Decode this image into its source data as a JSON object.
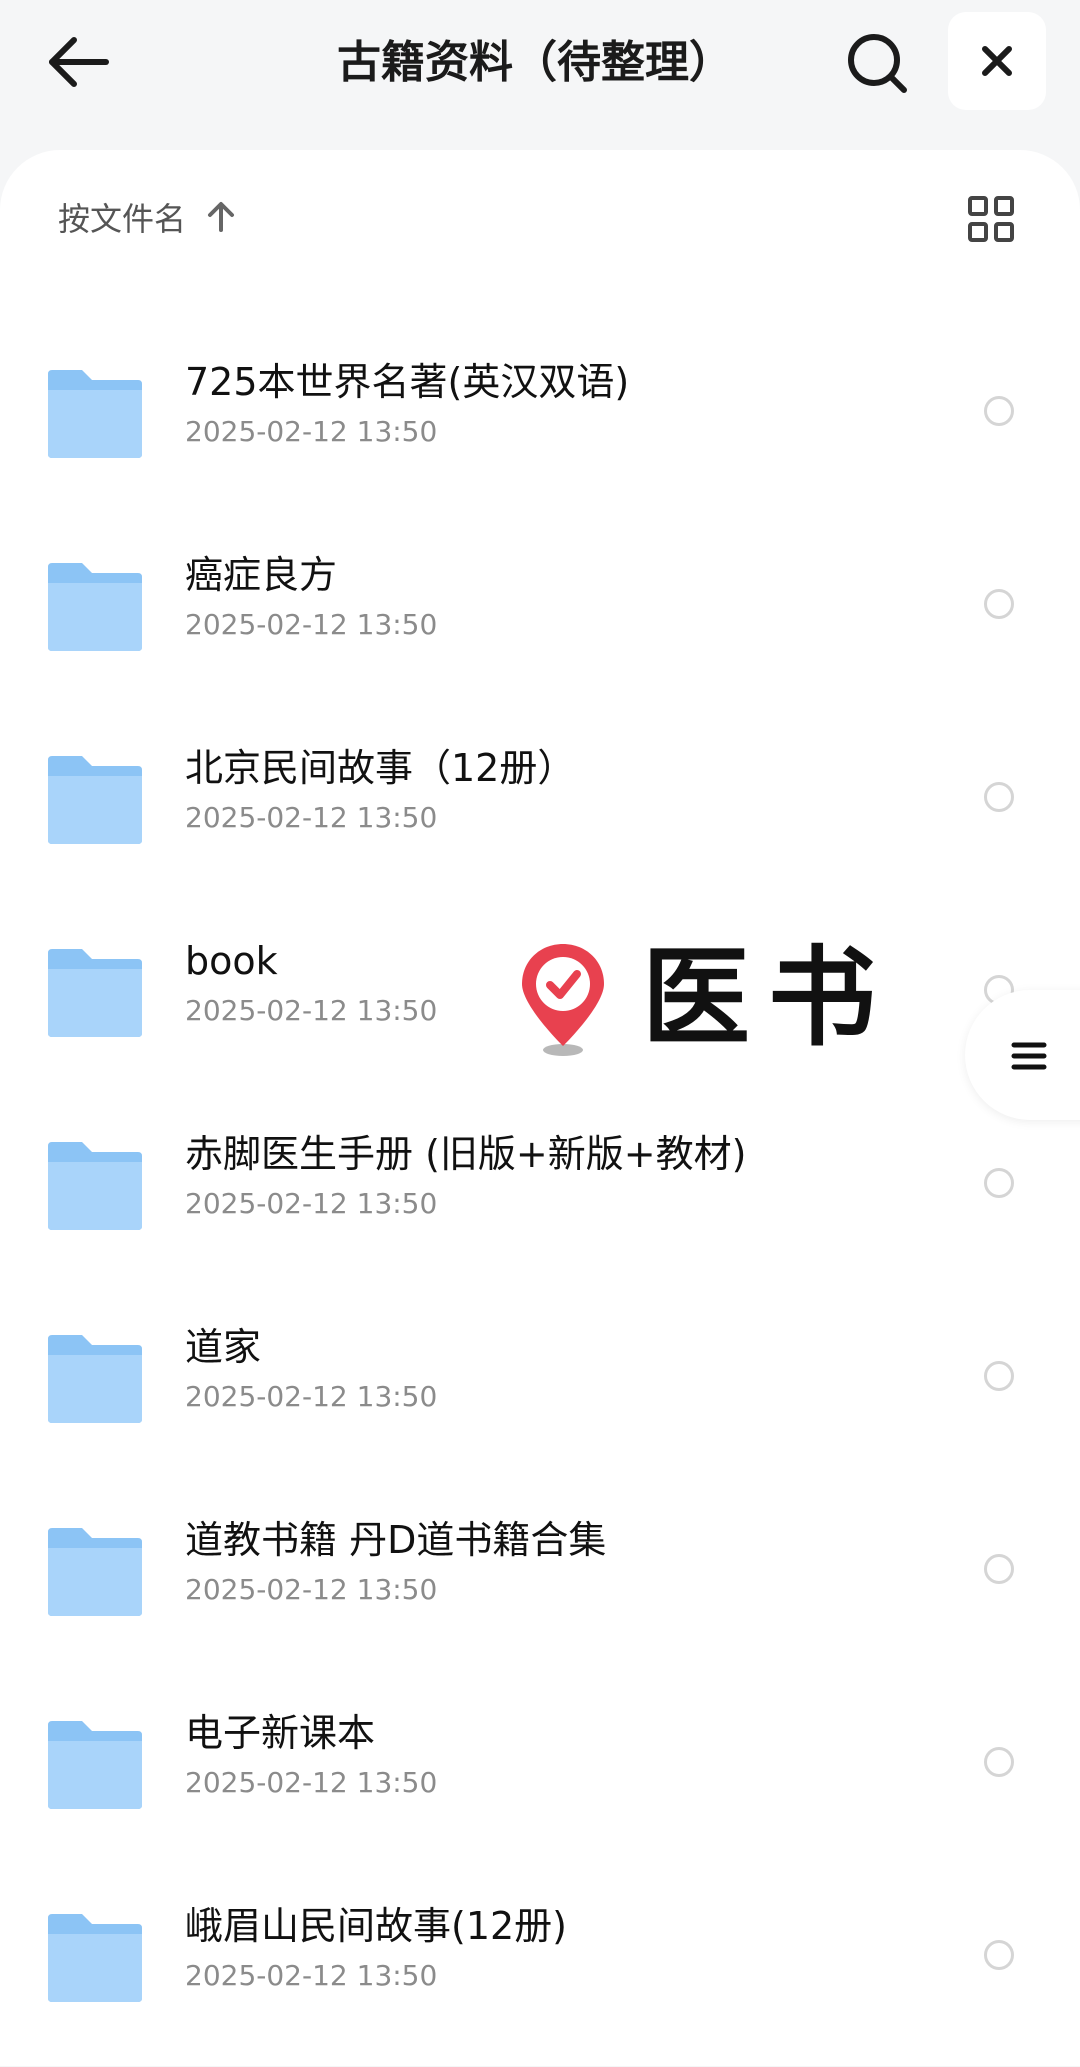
{
  "header": {
    "title": "古籍资料（待整理）",
    "back_icon": "arrow-left-icon",
    "search_icon": "search-icon",
    "close_icon": "close-icon"
  },
  "sortbar": {
    "label": "按文件名",
    "direction_icon": "arrow-up-icon",
    "view_icon": "grid-view-icon"
  },
  "files": [
    {
      "name": " 725本世界名著(英汉双语)",
      "date": "2025-02-12 13:50"
    },
    {
      "name": "癌症良方",
      "date": "2025-02-12 13:50"
    },
    {
      "name": "北京民间故事（12册）",
      "date": "2025-02-12 13:50"
    },
    {
      "name": "book",
      "date": "2025-02-12 13:50"
    },
    {
      "name": "赤脚医生手册 (旧版+新版+教材)",
      "date": "2025-02-12 13:50"
    },
    {
      "name": "道家",
      "date": "2025-02-12 13:50"
    },
    {
      "name": "道教书籍 丹D道书籍合集",
      "date": "2025-02-12 13:50"
    },
    {
      "name": "电子新课本",
      "date": "2025-02-12 13:50"
    },
    {
      "name": "峨眉山民间故事(12册)",
      "date": "2025-02-12 13:50"
    }
  ],
  "watermark": {
    "text": "医书",
    "icon": "location-check-pin-icon"
  },
  "side_menu": {
    "icon": "menu-lines-icon"
  },
  "colors": {
    "folder": "#8cc4f5",
    "watermark_pin": "#e8414f"
  }
}
